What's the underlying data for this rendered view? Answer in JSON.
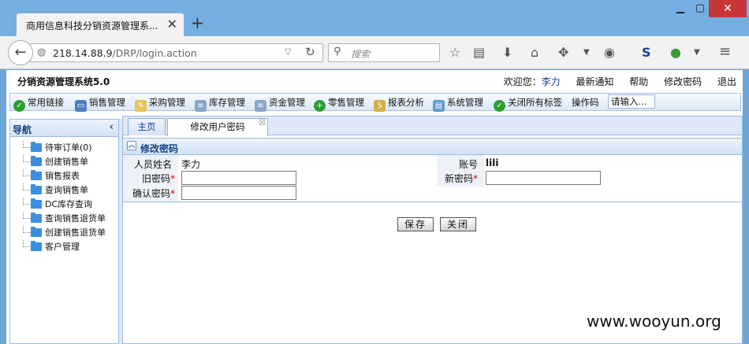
{
  "browser": {
    "tab_title": "商用信息科技分销资源管理系...",
    "url_host": "218.14.88.9",
    "url_path": "/DRP/login.action",
    "search_placeholder": "搜索"
  },
  "app": {
    "title": "分销资源管理系统5.0",
    "header": {
      "welcome_label": "欢迎您：",
      "user_name": "李力",
      "links": [
        "最新通知",
        "帮助",
        "修改密码",
        "退出"
      ]
    },
    "menu": [
      {
        "label": "常用链接",
        "icon": "check-icon"
      },
      {
        "label": "销售管理",
        "icon": "window-icon"
      },
      {
        "label": "采购管理",
        "icon": "edit-doc-icon"
      },
      {
        "label": "库存管理",
        "icon": "list-doc-icon"
      },
      {
        "label": "资金管理",
        "icon": "list-doc-icon"
      },
      {
        "label": "零售管理",
        "icon": "plus-circle-icon"
      },
      {
        "label": "报表分析",
        "icon": "s-report-icon"
      },
      {
        "label": "系统管理",
        "icon": "gradient-window-icon"
      },
      {
        "label": "关闭所有标签",
        "icon": "check-icon"
      }
    ],
    "op_code_label": "操作码",
    "op_code_value": "请输入...",
    "sidebar": {
      "title": "导航",
      "items": [
        "待审订单(0)",
        "创建销售单",
        "销售报表",
        "查询销售单",
        "DC库存查询",
        "查询销售退货单",
        "创建销售退货单",
        "客户管理"
      ]
    },
    "tabs": [
      "主页",
      "修改用户密码"
    ],
    "panel": {
      "title": "修改密码",
      "name_label": "人员姓名",
      "name_value": "李力",
      "account_label": "账号",
      "account_value": "lili",
      "old_password_label": "旧密码",
      "new_password_label": "新密码",
      "confirm_password_label": "确认密码",
      "required_mark": "*",
      "save_button": "保存",
      "close_button": "关闭"
    }
  },
  "watermark": "www.wooyun.org"
}
